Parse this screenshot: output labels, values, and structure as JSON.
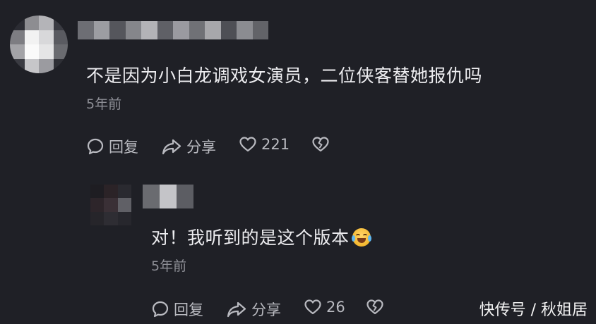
{
  "main_comment": {
    "text": "不是因为小白龙调戏女演员，二位侠客替她报仇吗",
    "time": "5年前",
    "actions": {
      "reply_label": "回复",
      "share_label": "分享",
      "like_count": "221"
    }
  },
  "reply_comment": {
    "text": "对！我听到的是这个版本",
    "emoji": "crying-laughing-emoji",
    "time": "5年前",
    "actions": {
      "reply_label": "回复",
      "share_label": "分享",
      "like_count": "26"
    }
  },
  "watermark": "快传号 / 秋姐居",
  "colors": {
    "background": "#1f2026",
    "text": "#ededf0",
    "muted": "#8e8f96"
  }
}
